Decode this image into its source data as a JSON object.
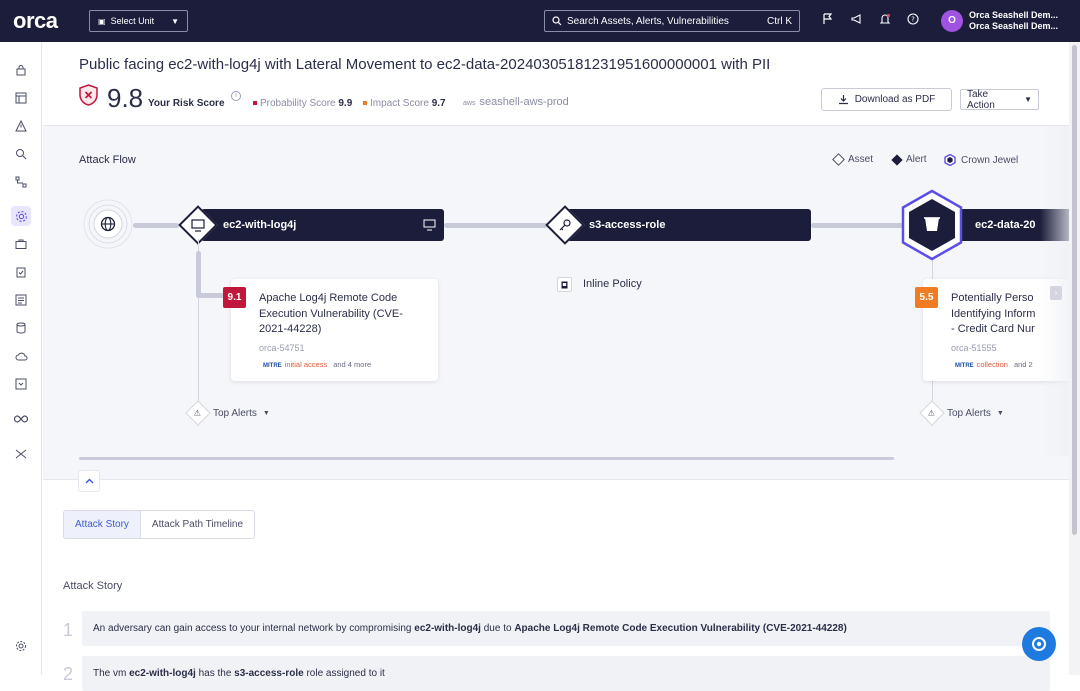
{
  "topbar": {
    "logo": "orca",
    "select_unit": "Select Unit",
    "search_placeholder": "Search Assets, Alerts, Vulnerabilities",
    "search_shortcut": "Ctrl K",
    "user_initial": "O",
    "user_name": "Orca Seashell Dem...",
    "user_org": "Orca Seashell Dem..."
  },
  "sidebar": {
    "items": [
      "lock-icon",
      "layout-icon",
      "alert-icon",
      "search-icon",
      "graph-icon",
      "attack-path-icon",
      "briefcase-icon",
      "clipboard-check-icon",
      "list-icon",
      "database-icon",
      "cloud-icon",
      "inbox-icon",
      "infinity-icon",
      "shuffle-icon",
      "settings-icon"
    ],
    "active": "attack-path-icon"
  },
  "header": {
    "title": "Public facing ec2-with-log4j with Lateral Movement to ec2-data-20240305181231951600000001 with PII",
    "risk_score": "9.8",
    "risk_label": "Your Risk Score",
    "probability_label": "Probability Score",
    "probability_value": "9.9",
    "impact_label": "Impact Score",
    "impact_value": "9.7",
    "account": "seashell-aws-prod",
    "account_provider": "aws",
    "download_label": "Download as PDF",
    "take_action_label": "Take Action"
  },
  "attack_flow": {
    "title": "Attack Flow",
    "legend": {
      "asset": "Asset",
      "alert": "Alert",
      "crown_jewel": "Crown Jewel"
    },
    "nodes": [
      {
        "label": "ec2-with-log4j"
      },
      {
        "label": "s3-access-role"
      },
      {
        "label": "ec2-data-20"
      }
    ],
    "inline_policy": "Inline Policy",
    "alerts": [
      {
        "score": "9.1",
        "title_lines": [
          "Apache Log4j Remote Code",
          "Execution Vulnerability (CVE-",
          "2021-44228)"
        ],
        "id": "orca-54751",
        "mitre": "MITRE",
        "tactic": "initial access",
        "more": "and 4 more"
      },
      {
        "score": "5.5",
        "title_lines": [
          "Potentially Perso",
          "Identifying Inform",
          "- Credit Card Nur"
        ],
        "id": "orca-51555",
        "mitre": "MITRE",
        "tactic": "collection",
        "more": "and 2"
      }
    ],
    "top_alerts": "Top Alerts"
  },
  "tabs": [
    "Attack Story",
    "Attack Path Timeline"
  ],
  "story": {
    "title": "Attack Story",
    "steps": [
      {
        "num": "1",
        "pre": "An adversary can gain access to your internal network by compromising ",
        "b1": "ec2-with-log4j",
        "mid": " due to ",
        "b2": "Apache Log4j Remote Code Execution Vulnerability (CVE-2021-44228)",
        "post": ""
      },
      {
        "num": "2",
        "pre": "The vm ",
        "b1": "ec2-with-log4j",
        "mid": " has the ",
        "b2": "s3-access-role",
        "post": " role assigned to it"
      }
    ]
  },
  "colors": {
    "navy": "#1b1d3a",
    "accent": "#5b4fe8",
    "critical": "#c0173a",
    "medium": "#f07b22"
  }
}
